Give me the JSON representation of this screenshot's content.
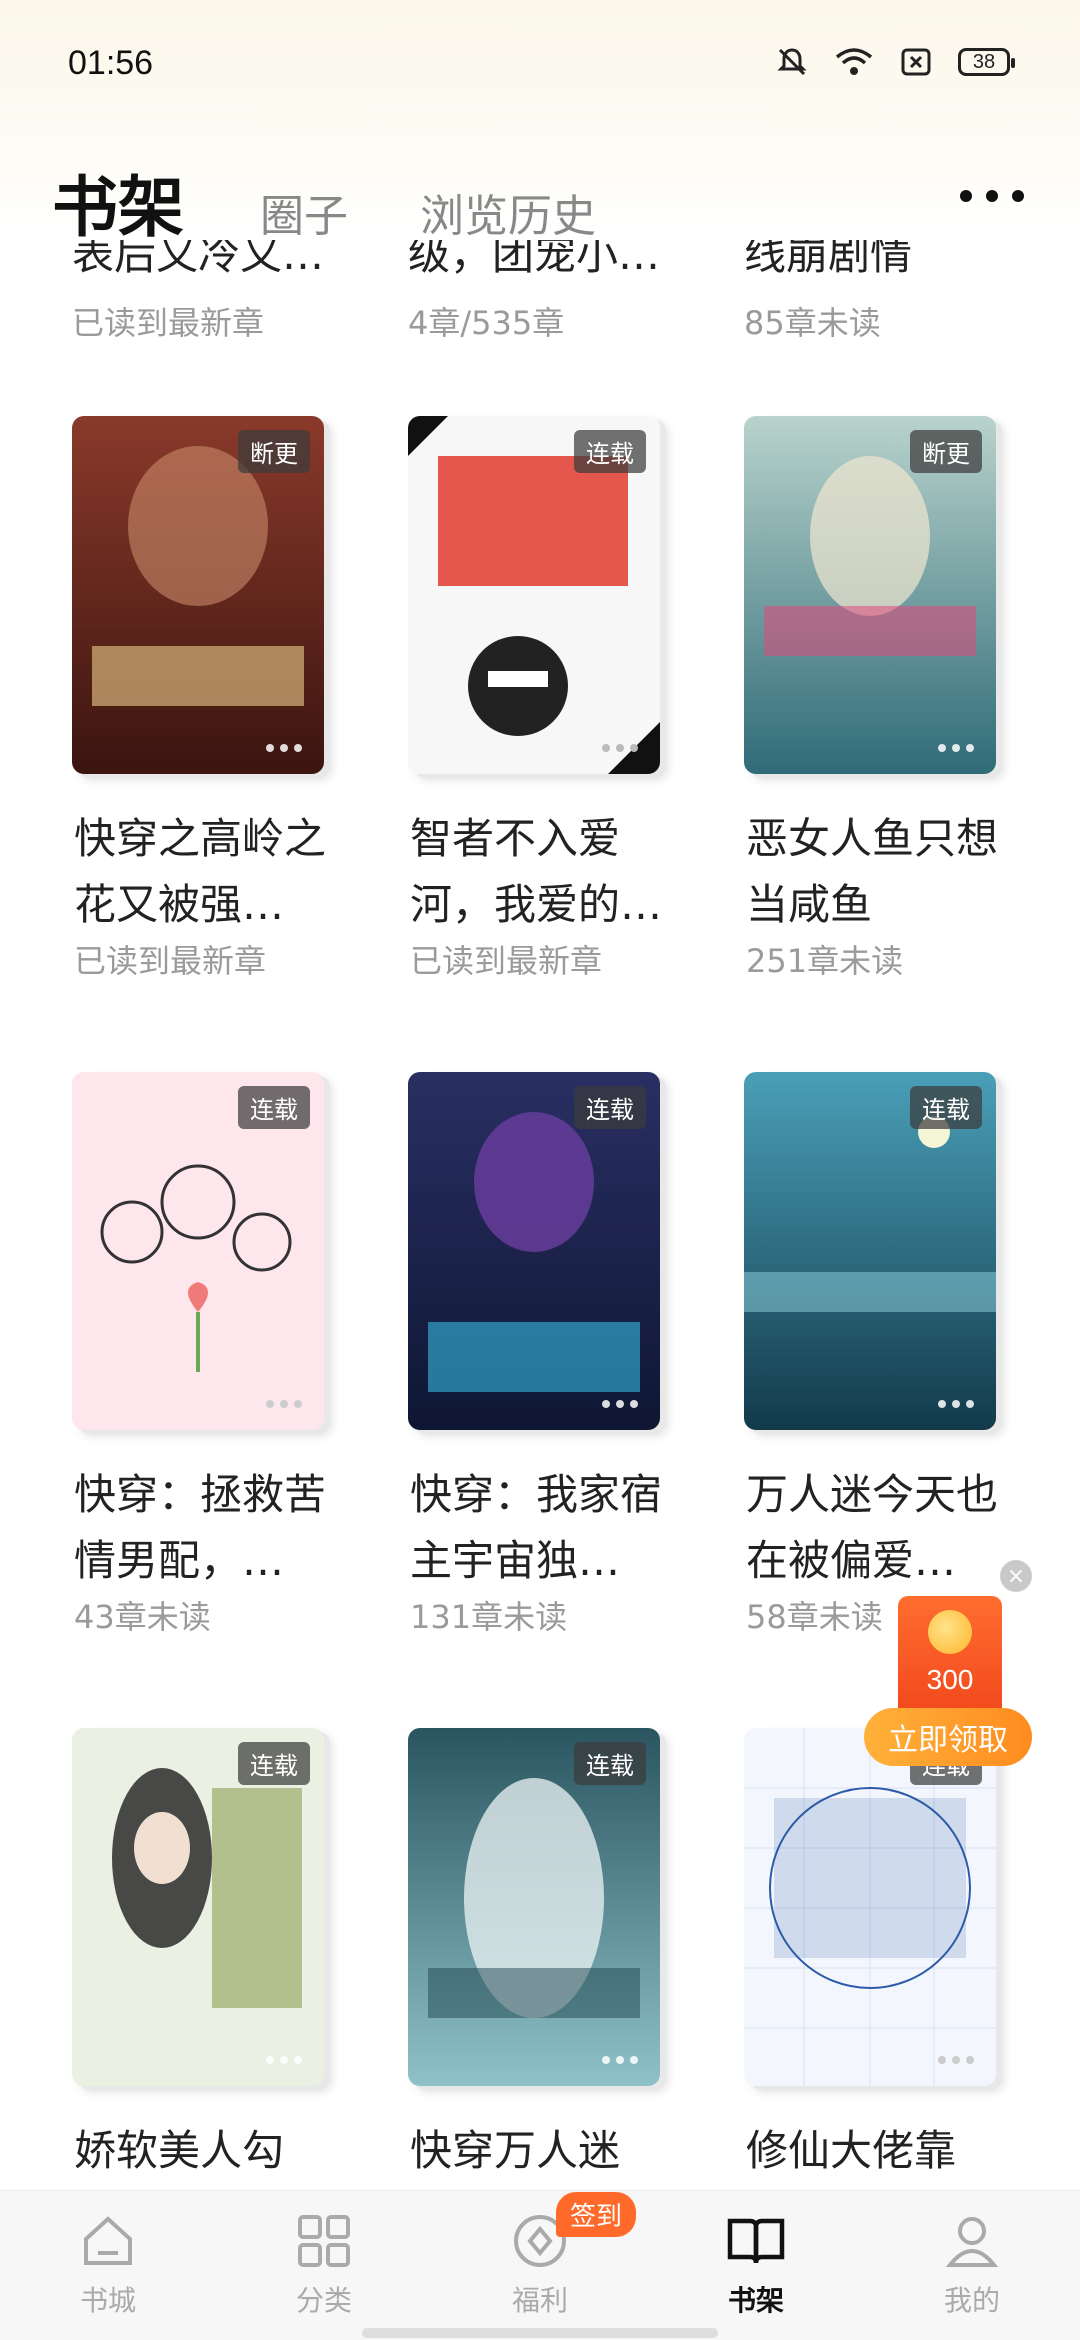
{
  "status_bar": {
    "time": "01:56",
    "battery": "38",
    "icons": [
      "mute-bell-icon",
      "wifi-icon",
      "sim-off-icon",
      "battery-icon"
    ]
  },
  "header": {
    "tabs": [
      "书架",
      "圈子",
      "浏览历史"
    ],
    "active_tab": "书架",
    "more_icon": "more-dots-icon"
  },
  "partial_row": [
    {
      "title": "表后又冷又…",
      "progress": "已读到最新章"
    },
    {
      "title": "级，团宠小…",
      "progress": "4章/535章"
    },
    {
      "title": "线崩剧情",
      "progress": "85章未读"
    }
  ],
  "books": [
    {
      "title": "快穿之高岭之花又被强…",
      "progress": "已读到最新章",
      "badge": "断更",
      "cover_color": "#6b2a20"
    },
    {
      "title": "智者不入爱河，我爱的…",
      "progress": "已读到最新章",
      "badge": "连载",
      "cover_color": "#f4f4f4"
    },
    {
      "title": "恶女人鱼只想当咸鱼",
      "progress": "251章未读",
      "badge": "断更",
      "cover_color": "#6aa2a8"
    },
    {
      "title": "快穿：拯救苦情男配，…",
      "progress": "43章未读",
      "badge": "连载",
      "cover_color": "#fbe3ea"
    },
    {
      "title": "快穿：我家宿主宇宙独…",
      "progress": "131章未读",
      "badge": "连载",
      "cover_color": "#1a2b5a"
    },
    {
      "title": "万人迷今天也在被偏爱…",
      "progress": "58章未读",
      "badge": "连载",
      "cover_color": "#2f6f8a"
    },
    {
      "title": "娇软美人勾",
      "progress": "",
      "badge": "连载",
      "cover_color": "#e7ede0"
    },
    {
      "title": "快穿万人迷",
      "progress": "",
      "badge": "连载",
      "cover_color": "#3a6f7a"
    },
    {
      "title": "修仙大佬靠",
      "progress": "",
      "badge": "连载",
      "cover_color": "#eef3fb"
    }
  ],
  "promo": {
    "amount": "300",
    "button_label": "立即领取",
    "close_label": "×"
  },
  "bottom_nav": {
    "items": [
      {
        "label": "书城",
        "icon": "home-icon"
      },
      {
        "label": "分类",
        "icon": "grid-icon"
      },
      {
        "label": "福利",
        "icon": "gift-icon"
      },
      {
        "label": "书架",
        "icon": "book-icon"
      },
      {
        "label": "我的",
        "icon": "user-icon"
      }
    ],
    "active": "书架",
    "badge": "签到"
  }
}
